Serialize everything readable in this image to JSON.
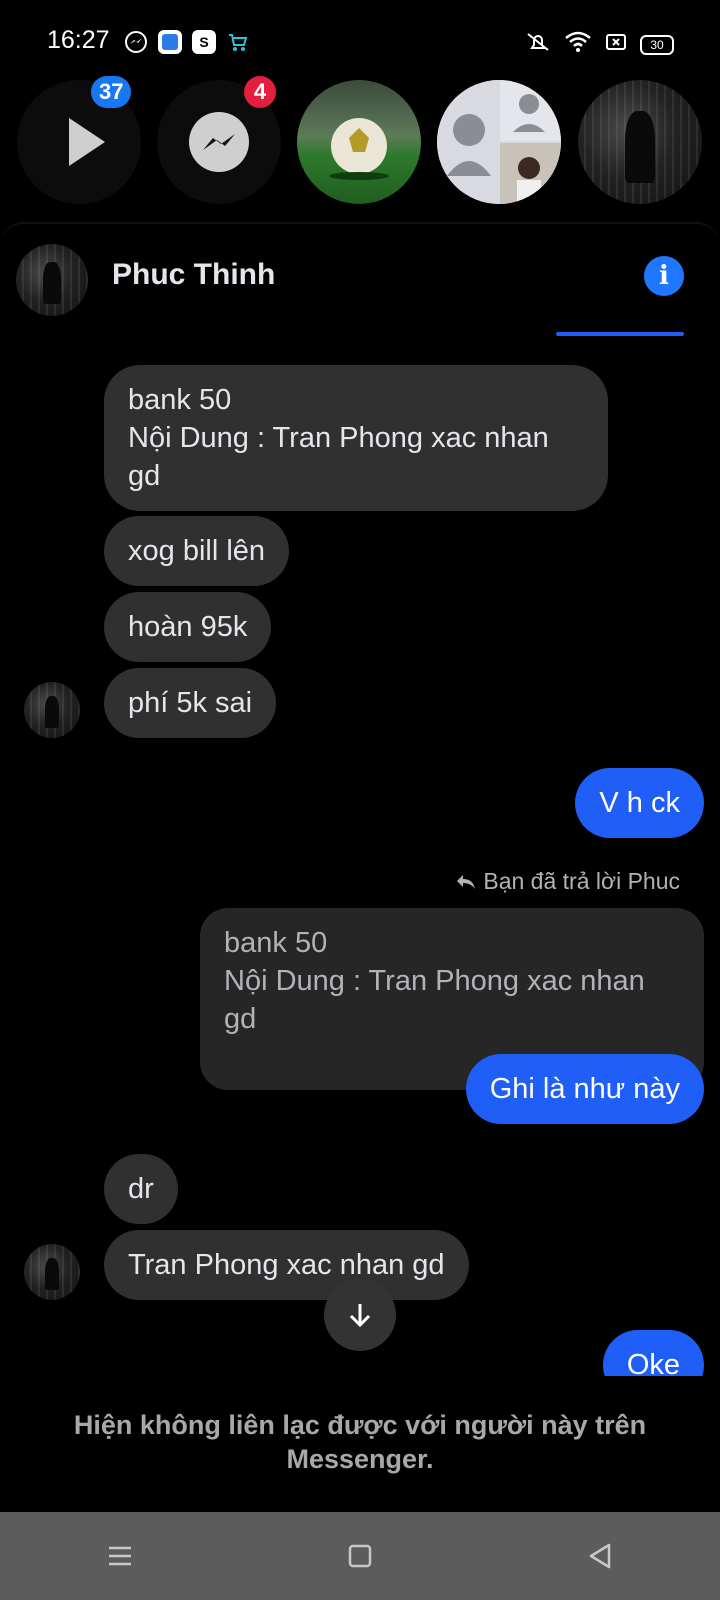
{
  "status_bar": {
    "time": "16:27",
    "battery": "30",
    "left_icons": [
      "messenger-icon",
      "blue-app-icon",
      "shopee-icon",
      "cart-app-icon"
    ],
    "right_icons": [
      "silent-icon",
      "wifi-icon",
      "screen-icon",
      "battery-icon"
    ]
  },
  "chat_heads": {
    "watch_badge": "37",
    "messenger_badge": "4"
  },
  "header": {
    "contact_name": "Phuc Thinh"
  },
  "messages": {
    "m1": "bank 50\nNội Dung : Tran Phong xac nhan gd",
    "m2": "xog bill lên",
    "m3": "hoàn 95k",
    "m4": "phí 5k sai",
    "m5": "V h ck",
    "reply_note": "Bạn đã trả lời Phuc",
    "quoted": "bank 50\nNội Dung : Tran Phong xac nhan gd",
    "m6": "Ghi là như này",
    "m7": "dr",
    "m8": "Tran Phong xac nhan gd",
    "m9": "Oke"
  },
  "footer": {
    "unreachable": "Hiện không liên lạc được với người này trên Messenger."
  },
  "colors": {
    "outgoing": "#1f5ef7",
    "incoming": "#303030",
    "badge_blue": "#1877f2",
    "badge_red": "#e41e3f"
  }
}
